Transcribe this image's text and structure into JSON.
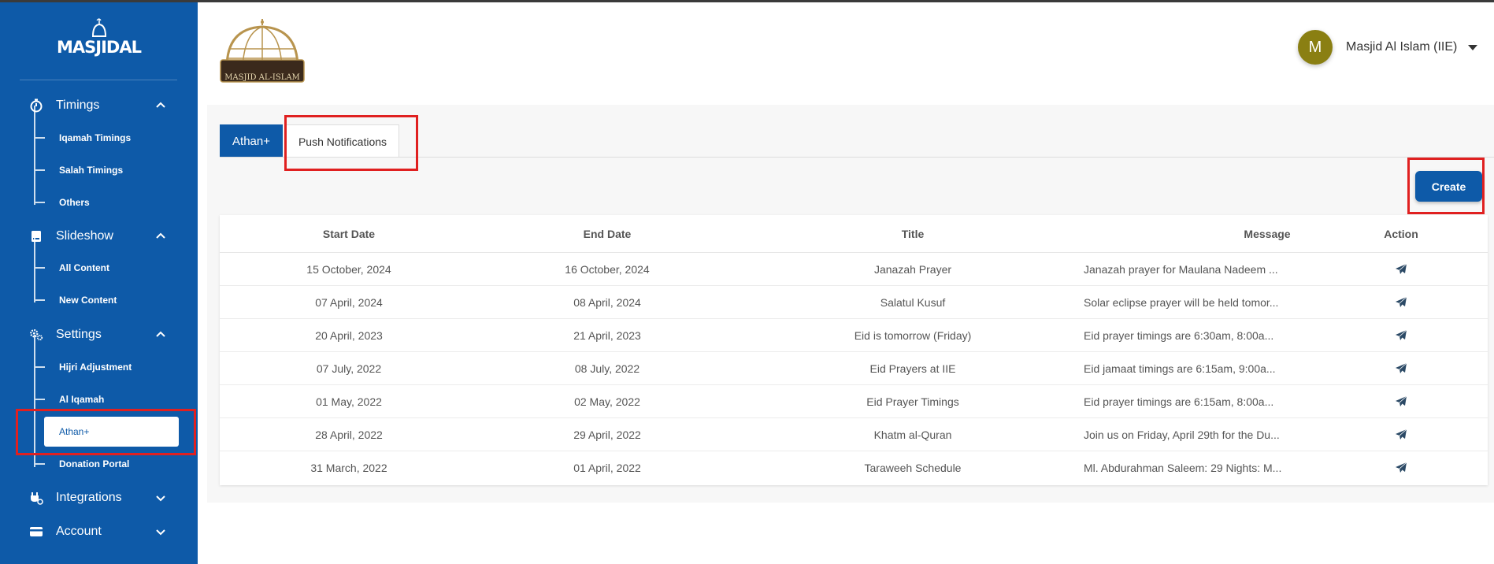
{
  "app": {
    "logo_text": "MASJIDAL",
    "brand_logo_text": "MASJID AL-ISLAM"
  },
  "sidebar": {
    "sections": [
      {
        "label": "Timings",
        "icon": "timer-icon",
        "expanded": true,
        "items": [
          {
            "label": "Iqamah Timings"
          },
          {
            "label": "Salah Timings"
          },
          {
            "label": "Others"
          }
        ]
      },
      {
        "label": "Slideshow",
        "icon": "slideshow-icon",
        "expanded": true,
        "items": [
          {
            "label": "All Content"
          },
          {
            "label": "New Content"
          }
        ]
      },
      {
        "label": "Settings",
        "icon": "settings-gears-icon",
        "expanded": true,
        "items": [
          {
            "label": "Hijri Adjustment"
          },
          {
            "label": "Al Iqamah"
          },
          {
            "label": "Athan+",
            "active": true
          },
          {
            "label": "Donation Portal"
          }
        ]
      },
      {
        "label": "Integrations",
        "icon": "plug-icon",
        "expanded": false,
        "items": []
      },
      {
        "label": "Account",
        "icon": "card-icon",
        "expanded": false,
        "items": []
      }
    ]
  },
  "header": {
    "user_initial": "M",
    "user_name": "Masjid Al Islam (IIE)"
  },
  "tabs": [
    {
      "label": "Athan+"
    },
    {
      "label": "Push Notifications",
      "selected": true
    }
  ],
  "toolbar": {
    "create_label": "Create"
  },
  "table": {
    "headers": {
      "start": "Start Date",
      "end": "End Date",
      "title": "Title",
      "message": "Message",
      "action": "Action"
    },
    "rows": [
      {
        "start": "15 October, 2024",
        "end": "16 October, 2024",
        "title": "Janazah Prayer",
        "message": "Janazah prayer for Maulana Nadeem ..."
      },
      {
        "start": "07 April, 2024",
        "end": "08 April, 2024",
        "title": "Salatul Kusuf",
        "message": "Solar eclipse prayer will be held tomor..."
      },
      {
        "start": "20 April, 2023",
        "end": "21 April, 2023",
        "title": "Eid is tomorrow (Friday)",
        "message": "Eid prayer timings are 6:30am, 8:00a..."
      },
      {
        "start": "07 July, 2022",
        "end": "08 July, 2022",
        "title": "Eid Prayers at IIE",
        "message": "Eid jamaat timings are 6:15am, 9:00a..."
      },
      {
        "start": "01 May, 2022",
        "end": "02 May, 2022",
        "title": "Eid Prayer Timings",
        "message": "Eid prayer timings are 6:15am, 8:00a..."
      },
      {
        "start": "28 April, 2022",
        "end": "29 April, 2022",
        "title": "Khatm al-Quran",
        "message": "Join us on Friday, April 29th for the Du..."
      },
      {
        "start": "31 March, 2022",
        "end": "01 April, 2022",
        "title": "Taraweeh Schedule",
        "message": "Ml. Abdurahman Saleem: 29 Nights: M..."
      }
    ]
  },
  "colors": {
    "primary": "#0e5aa8",
    "avatar": "#8a7f12",
    "highlight": "#e02020"
  }
}
